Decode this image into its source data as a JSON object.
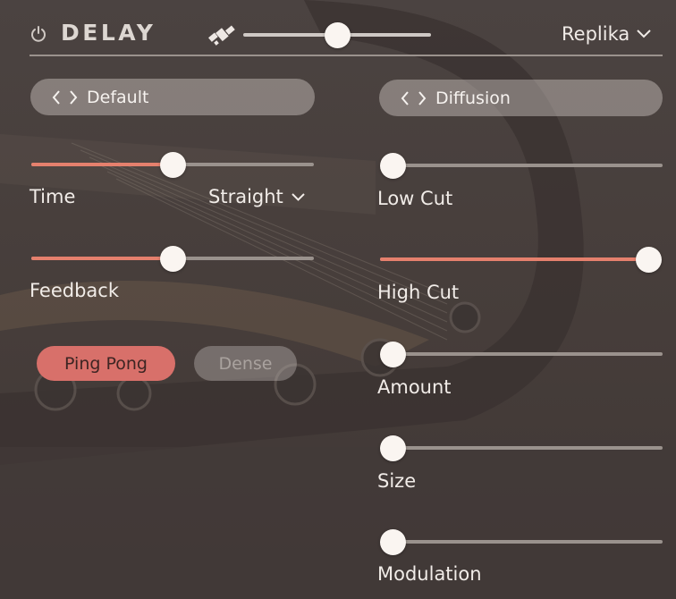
{
  "header": {
    "title": "DELAY",
    "preset_menu": "Replika",
    "mix_slider_value": 0.5
  },
  "left": {
    "preset_label": "Default",
    "time": {
      "label": "Time",
      "value": 0.5,
      "mode": "Straight"
    },
    "feedback": {
      "label": "Feedback",
      "value": 0.5
    },
    "buttons": [
      {
        "label": "Ping Pong",
        "active": true
      },
      {
        "label": "Dense",
        "active": false
      }
    ]
  },
  "right": {
    "preset_label": "Diffusion",
    "sliders": [
      {
        "label": "Low Cut",
        "value": 0.0
      },
      {
        "label": "High Cut",
        "value": 1.0
      },
      {
        "label": "Amount",
        "value": 0.0
      },
      {
        "label": "Size",
        "value": 0.0
      },
      {
        "label": "Modulation",
        "value": 0.0
      }
    ]
  },
  "colors": {
    "accent": "#e5806d",
    "track": "#9a928d",
    "thumb": "#faf5f1",
    "active_button": "#d8706a"
  },
  "icons": [
    "power-icon",
    "satellite-icon",
    "chevron-left-icon",
    "chevron-right-icon",
    "chevron-down-icon"
  ]
}
